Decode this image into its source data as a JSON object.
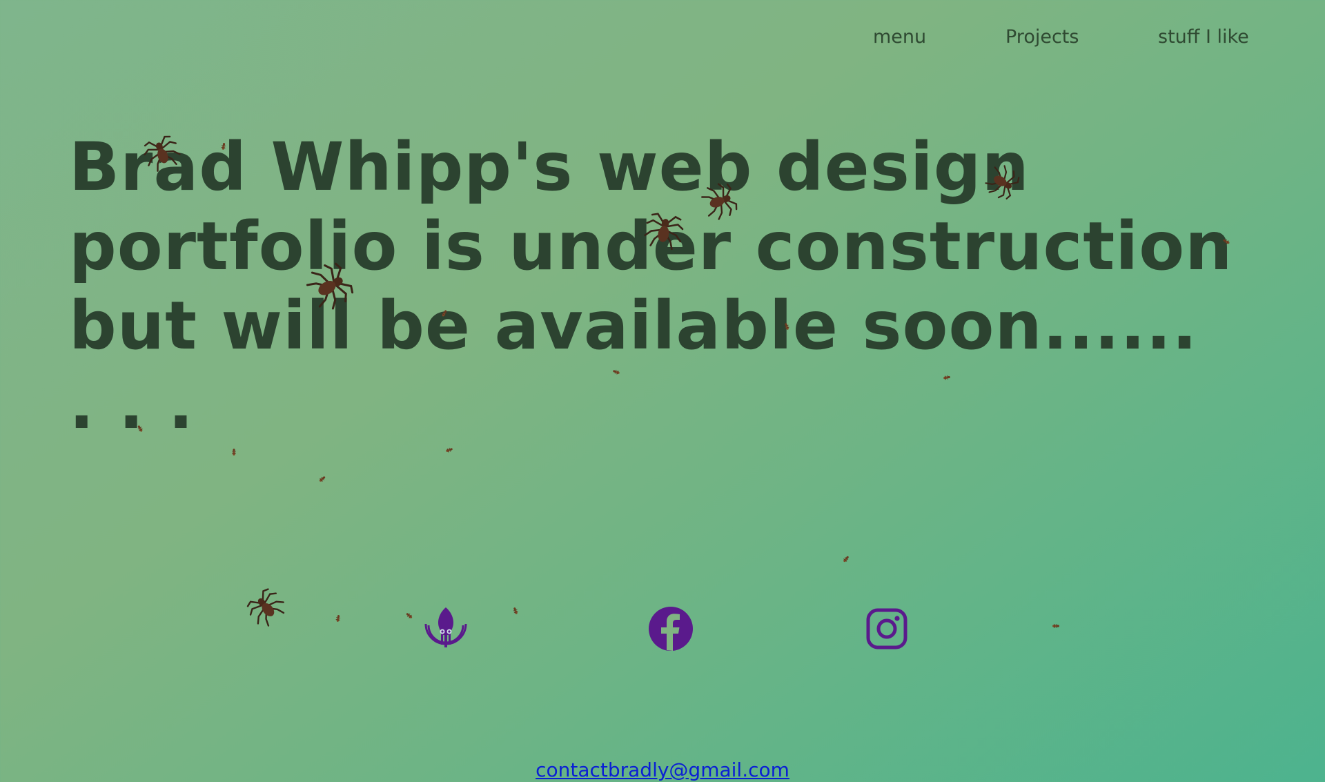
{
  "nav": {
    "items": [
      {
        "label": "menu"
      },
      {
        "label": "Projects"
      },
      {
        "label": "stuff I like"
      }
    ]
  },
  "hero": {
    "headline": "Brad Whipp's web design portfolio is under construction but will be available soon...... . . ."
  },
  "social": {
    "icons": [
      "gitkraken-icon",
      "facebook-icon",
      "instagram-icon"
    ],
    "icon_color": "#5a1a8c"
  },
  "contact": {
    "email": "contactbradly@gmail.com"
  },
  "colors": {
    "headline": "#2c4330",
    "nav_text": "#2f4a32",
    "link": "#0a1fd4",
    "background_start": "#7fb58c",
    "background_end": "#4db38e"
  }
}
